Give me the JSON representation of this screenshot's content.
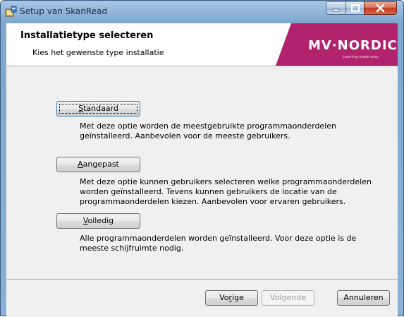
{
  "window": {
    "title": "Setup van SkanRead",
    "buttons": {
      "minimize": "minimize",
      "maximize": "maximize",
      "close": "close"
    }
  },
  "banner": {
    "title": "Installatietype selecteren",
    "subtitle": "Kies het gewenste type installatie",
    "logo": {
      "name": "MV·NORDIC",
      "tagline": "Learning made easy",
      "color": "#b2236e"
    }
  },
  "options": [
    {
      "key": "standard",
      "label_pre": "",
      "label_key": "S",
      "label_post": "tandaard",
      "description": [
        "Met deze optie worden de meestgebruikte programmaonderdelen",
        "geïnstalleerd. Aanbevolen voor de meeste gebruikers."
      ]
    },
    {
      "key": "custom",
      "label_pre": "",
      "label_key": "A",
      "label_post": "angepast",
      "description": [
        "Met deze optie kunnen gebruikers selecteren welke programmaonderdelen",
        "worden geïnstalleerd. Tevens kunnen gebruikers de locatie van de",
        "programmaonderdelen kiezen. Aanbevolen voor ervaren gebruikers."
      ]
    },
    {
      "key": "complete",
      "label_pre": "",
      "label_key": "V",
      "label_post": "olledig",
      "description": [
        "Alle programmaonderdelen worden geïnstalleerd. Voor deze optie is de",
        "meeste schijfruimte nodig."
      ]
    }
  ],
  "footer": {
    "back": {
      "pre": "Vo",
      "key": "r",
      "post": "ige"
    },
    "next": {
      "label": "Volgende",
      "enabled": false
    },
    "cancel": {
      "label": "Annuleren"
    }
  }
}
